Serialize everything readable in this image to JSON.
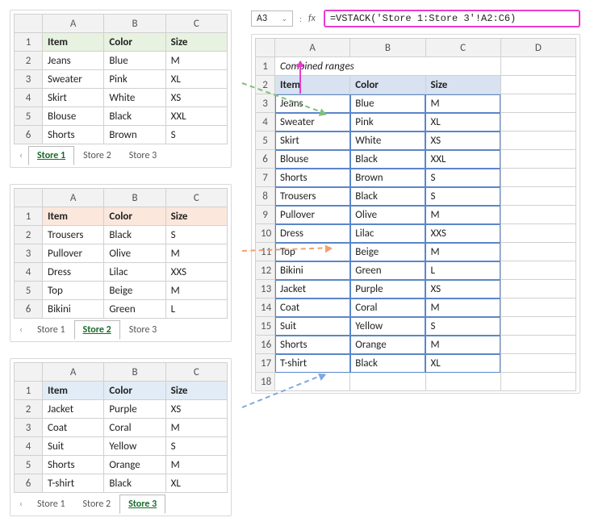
{
  "stores": [
    {
      "id": "store1",
      "tint": "tint-green",
      "activeTab": 0,
      "headers": [
        "Item",
        "Color",
        "Size"
      ],
      "rows": [
        [
          "Jeans",
          "Blue",
          "M"
        ],
        [
          "Sweater",
          "Pink",
          "XL"
        ],
        [
          "Skirt",
          "White",
          "XS"
        ],
        [
          "Blouse",
          "Black",
          "XXL"
        ],
        [
          "Shorts",
          "Brown",
          "S"
        ]
      ]
    },
    {
      "id": "store2",
      "tint": "tint-peach",
      "activeTab": 1,
      "headers": [
        "Item",
        "Color",
        "Size"
      ],
      "rows": [
        [
          "Trousers",
          "Black",
          "S"
        ],
        [
          "Pullover",
          "Olive",
          "M"
        ],
        [
          "Dress",
          "Lilac",
          "XXS"
        ],
        [
          "Top",
          "Beige",
          "M"
        ],
        [
          "Bikini",
          "Green",
          "L"
        ]
      ]
    },
    {
      "id": "store3",
      "tint": "tint-blue",
      "activeTab": 2,
      "headers": [
        "Item",
        "Color",
        "Size"
      ],
      "rows": [
        [
          "Jacket",
          "Purple",
          "XS"
        ],
        [
          "Coat",
          "Coral",
          "M"
        ],
        [
          "Suit",
          "Yellow",
          "S"
        ],
        [
          "Shorts",
          "Orange",
          "M"
        ],
        [
          "T-shirt",
          "Black",
          "XL"
        ]
      ]
    }
  ],
  "tab_labels": [
    "Store 1",
    "Store 2",
    "Store 3"
  ],
  "column_letters": [
    "A",
    "B",
    "C"
  ],
  "result": {
    "namebox": "A3",
    "formula": "=VSTACK('Store 1:Store 3'!A2:C6)",
    "title": "Combined ranges",
    "headers": [
      "Item",
      "Color",
      "Size"
    ],
    "column_letters": [
      "A",
      "B",
      "C",
      "D"
    ],
    "rows": [
      [
        "Jeans",
        "Blue",
        "M"
      ],
      [
        "Sweater",
        "Pink",
        "XL"
      ],
      [
        "Skirt",
        "White",
        "XS"
      ],
      [
        "Blouse",
        "Black",
        "XXL"
      ],
      [
        "Shorts",
        "Brown",
        "S"
      ],
      [
        "Trousers",
        "Black",
        "S"
      ],
      [
        "Pullover",
        "Olive",
        "M"
      ],
      [
        "Dress",
        "Lilac",
        "XXS"
      ],
      [
        "Top",
        "Beige",
        "M"
      ],
      [
        "Bikini",
        "Green",
        "L"
      ],
      [
        "Jacket",
        "Purple",
        "XS"
      ],
      [
        "Coat",
        "Coral",
        "M"
      ],
      [
        "Suit",
        "Yellow",
        "S"
      ],
      [
        "Shorts",
        "Orange",
        "M"
      ],
      [
        "T-shirt",
        "Black",
        "XL"
      ]
    ]
  },
  "glyphs": {
    "nav_prev": "‹",
    "dropdown": "⌄",
    "fx_sep": ":",
    "fx": "fx"
  }
}
